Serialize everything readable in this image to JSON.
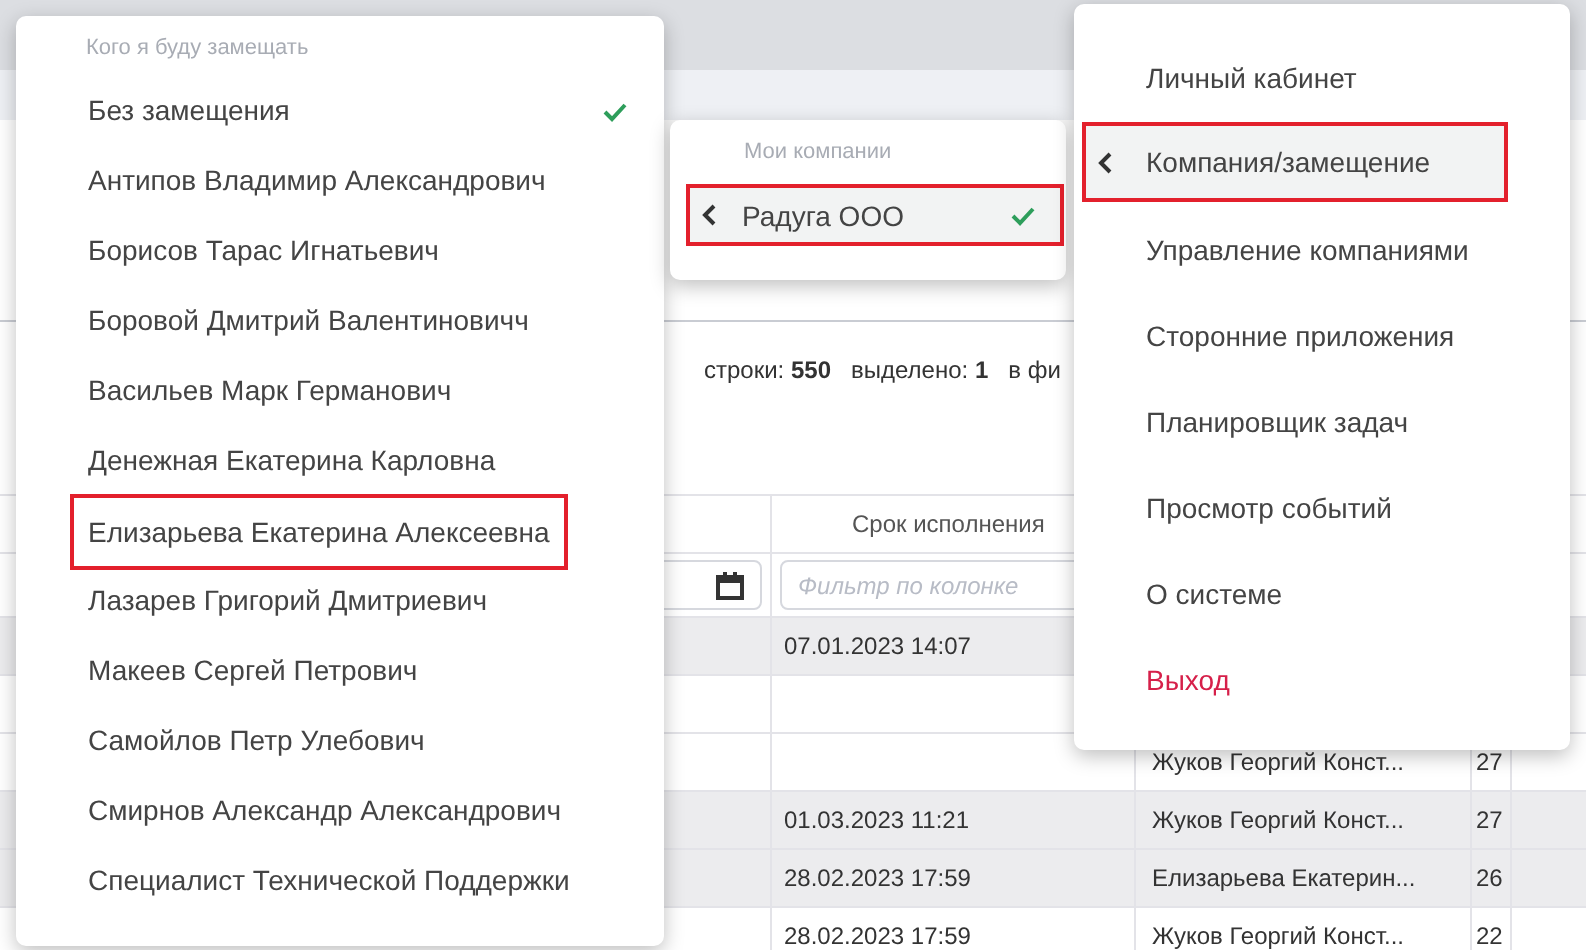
{
  "status": {
    "text": "строки: **550**   выделено: **1**   в фи"
  },
  "table": {
    "columns": [
      {
        "label": "Срок исполнения"
      }
    ],
    "filter": {
      "placeholder": "Фильтр по колонке"
    },
    "rows": [
      {
        "shaded": true,
        "due": "07.01.2023 14:07"
      },
      {
        "shaded": false
      },
      {
        "shaded": false,
        "column_3": "Жуков Георгий Конст...",
        "column_4": "27"
      },
      {
        "shaded": true,
        "due": "01.03.2023 11:21",
        "column_3": "Жуков Георгий Конст...",
        "column_4": "27"
      },
      {
        "shaded": true,
        "due": "28.02.2023 17:59",
        "column_3": "Елизарьева Екатерин...",
        "column_4": "26"
      },
      {
        "shaded": false,
        "due": "28.02.2023 17:59",
        "column_3": "Жуков Георгий Конст...",
        "column_4": "22"
      }
    ]
  },
  "substitute_menu": {
    "header": "Кого я буду замещать",
    "items": [
      {
        "label": "Без замещения",
        "checked": true,
        "highlighted": false
      },
      {
        "label": "Антипов Владимир Александрович",
        "checked": false,
        "highlighted": false
      },
      {
        "label": "Борисов Тарас Игнатьевич",
        "checked": false,
        "highlighted": false
      },
      {
        "label": "Боровой Дмитрий Валентиновичч",
        "checked": false,
        "highlighted": false
      },
      {
        "label": "Васильев Марк Германович",
        "checked": false,
        "highlighted": false
      },
      {
        "label": "Денежная Екатерина Карловна",
        "checked": false,
        "highlighted": false
      },
      {
        "label": "Елизарьева Екатерина Алексеевна",
        "checked": false,
        "highlighted": true
      },
      {
        "label": "Лазарев Григорий Дмитриевич",
        "checked": false,
        "highlighted": false
      },
      {
        "label": "Макеев Сергей Петрович",
        "checked": false,
        "highlighted": false
      },
      {
        "label": "Самойлов Петр Улебович",
        "checked": false,
        "highlighted": false
      },
      {
        "label": "Смирнов Александр Александрович",
        "checked": false,
        "highlighted": false
      },
      {
        "label": "Специалист Технической Поддержки",
        "checked": false,
        "highlighted": false
      }
    ]
  },
  "company_menu": {
    "header": "Мои компании",
    "items": [
      {
        "label": "Радуга ООО",
        "checked": true,
        "highlighted": true
      }
    ]
  },
  "user_menu": {
    "items": [
      {
        "label": "Личный кабинет",
        "kind": "normal",
        "highlighted": false
      },
      {
        "label": "Компания/замещение",
        "kind": "normal",
        "highlighted": true
      },
      {
        "label": "Управление компаниями",
        "kind": "normal",
        "highlighted": false
      },
      {
        "label": "Сторонние приложения",
        "kind": "normal",
        "highlighted": false
      },
      {
        "label": "Планировщик задач",
        "kind": "normal",
        "highlighted": false
      },
      {
        "label": "Просмотр событий",
        "kind": "normal",
        "highlighted": false
      },
      {
        "label": "О системе",
        "kind": "normal",
        "highlighted": false
      },
      {
        "label": "Выход",
        "kind": "danger",
        "highlighted": false
      }
    ]
  }
}
